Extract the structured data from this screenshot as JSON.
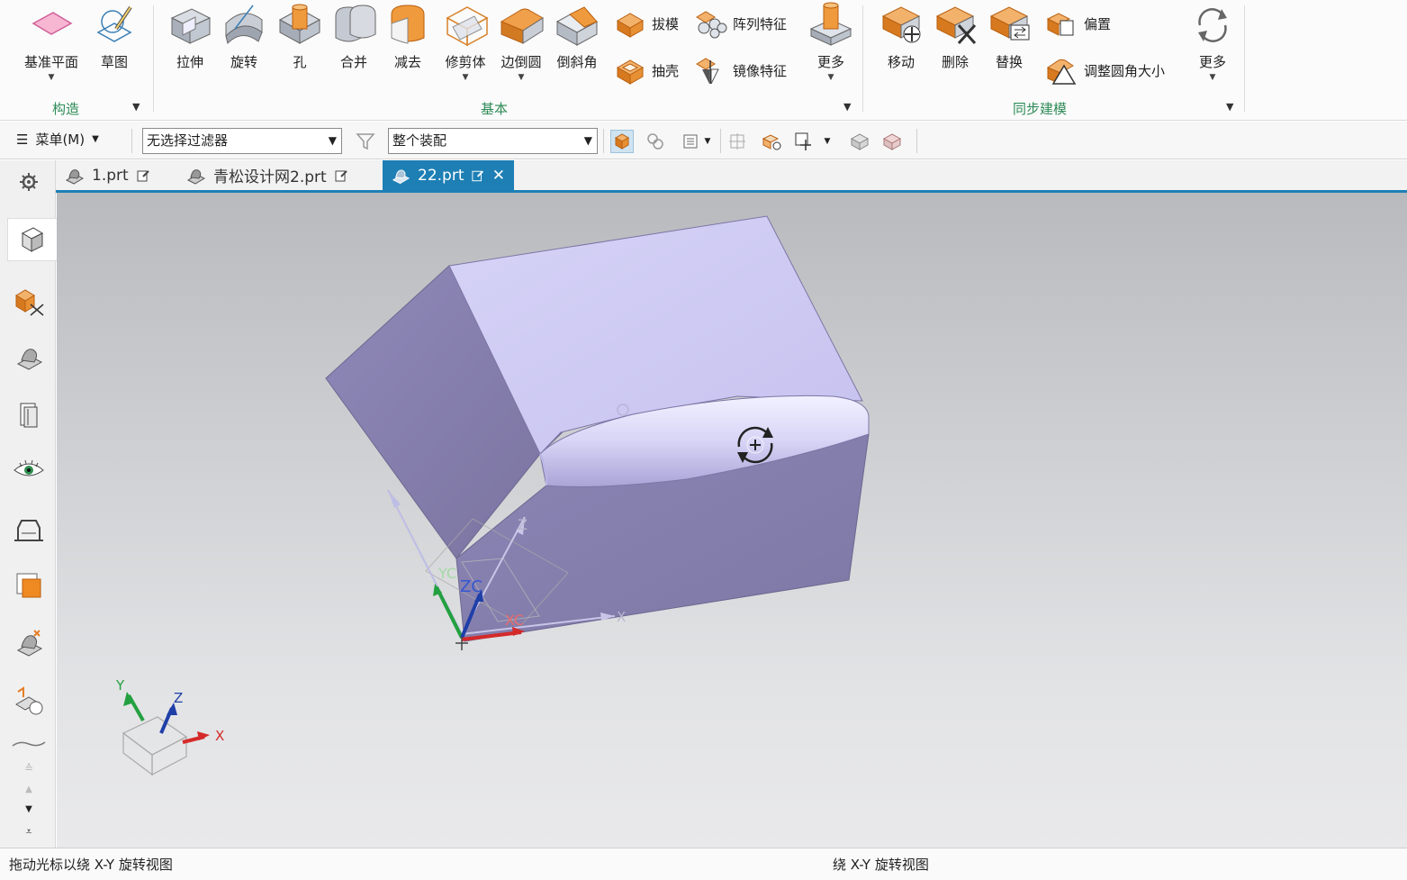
{
  "ribbon": {
    "groups": {
      "construct": {
        "label": "构造",
        "buttons": {
          "datum_plane": "基准平面",
          "sketch": "草图"
        }
      },
      "basic": {
        "label": "基本",
        "buttons": {
          "extrude": "拉伸",
          "revolve": "旋转",
          "hole": "孔",
          "unite": "合并",
          "subtract": "减去",
          "trim_body": "修剪体",
          "edge_blend": "边倒圆",
          "chamfer": "倒斜角",
          "draft": "拔模",
          "shell": "抽壳",
          "pattern_feature": "阵列特征",
          "mirror_feature": "镜像特征",
          "more": "更多"
        }
      },
      "sync": {
        "label": "同步建模",
        "buttons": {
          "move": "移动",
          "delete": "删除",
          "replace": "替换",
          "offset": "偏置",
          "resize_blend": "调整圆角大小",
          "more": "更多"
        }
      }
    },
    "colors": {
      "accent": "#2e8b57",
      "orange": "#e8892a"
    }
  },
  "toolbar": {
    "menu_label": "菜单(M)",
    "selection_filter": "无选择过滤器",
    "scope": "整个装配"
  },
  "tabs": [
    {
      "label": "1.prt"
    },
    {
      "label": "青松设计网2.prt"
    },
    {
      "label": "22.prt"
    }
  ],
  "viewport": {
    "triad_labels": {
      "x": "X",
      "y": "Y",
      "z": "Z"
    },
    "csys_labels": {
      "xc": "XC",
      "yc": "YC",
      "zc": "ZC"
    }
  },
  "status": {
    "left": "拖动光标以绕 X-Y 旋转视图",
    "middle": "绕 X-Y 旋转视图"
  }
}
